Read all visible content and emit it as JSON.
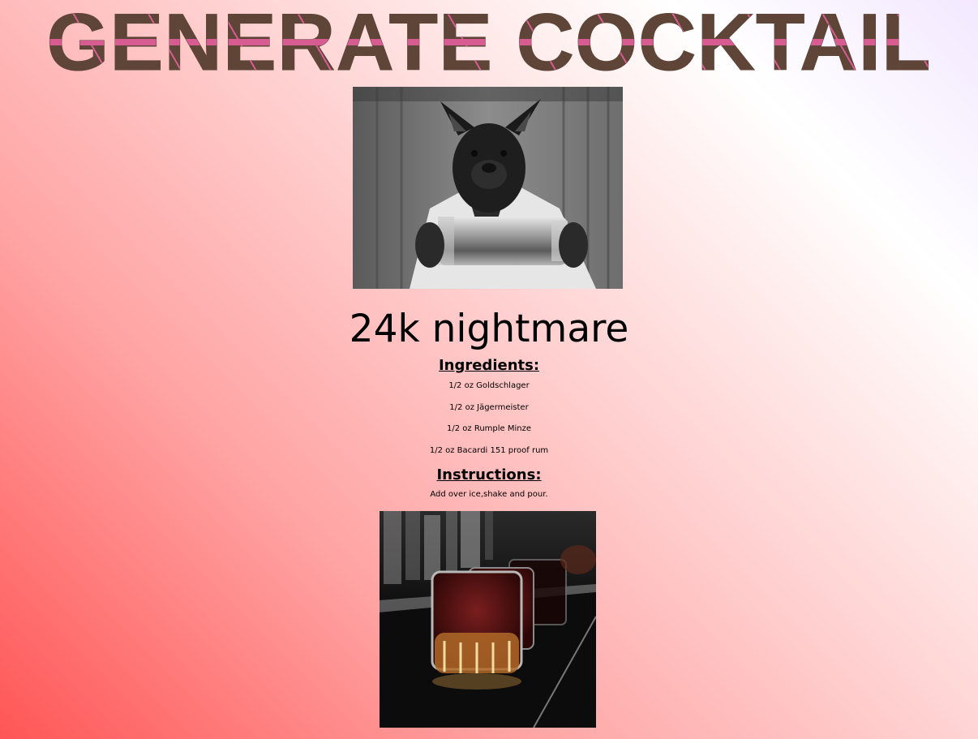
{
  "header": {
    "title": "GENERATE COCKTAIL"
  },
  "drink": {
    "name": "24k nightmare",
    "ingredients_heading": "Ingredients:",
    "ingredients": [
      "1/2 oz Goldschlager",
      "1/2 oz Jägermeister",
      "1/2 oz Rumple Minze",
      "1/2 oz Bacardi 151 proof rum"
    ],
    "instructions_heading": "Instructions:",
    "instructions": "Add over ice,shake and pour."
  },
  "colors": {
    "title": "#5e4537",
    "title_accent": "#d65c92",
    "gradient_light": "#ffffff",
    "gradient_dark": "#ff5656"
  }
}
